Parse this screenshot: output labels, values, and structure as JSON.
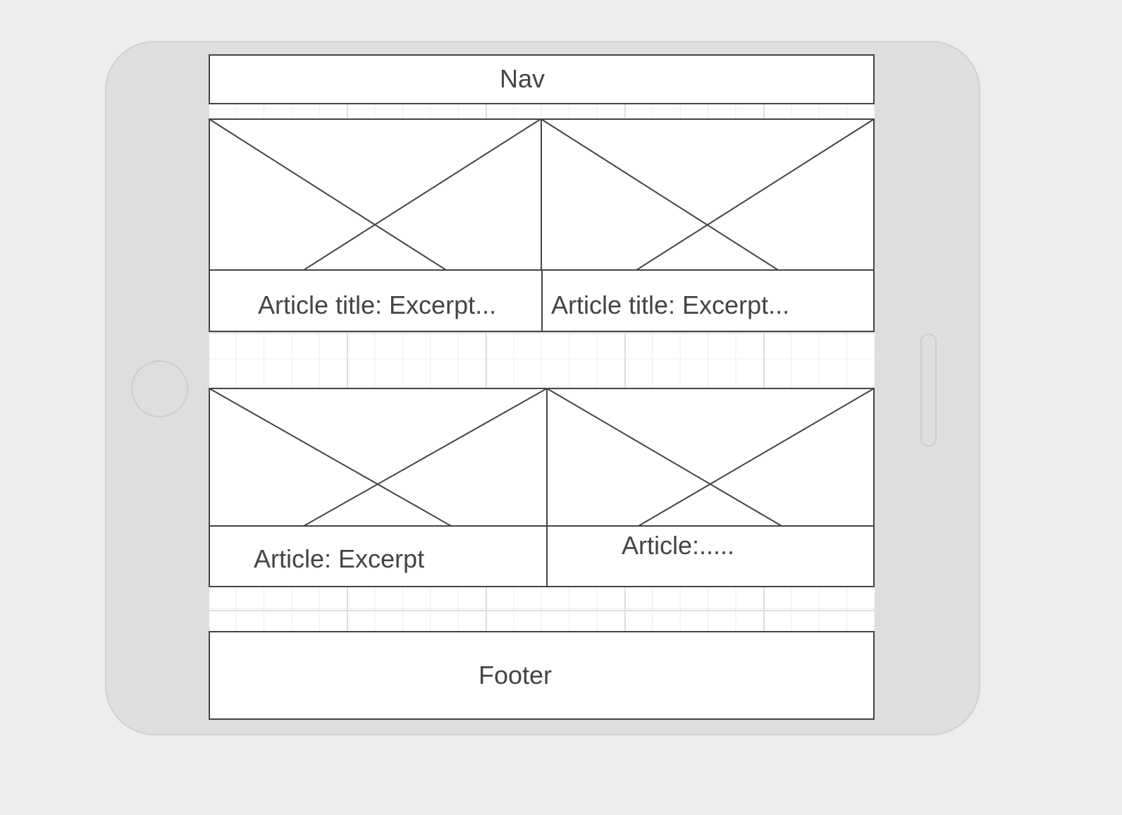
{
  "nav": {
    "label": "Nav"
  },
  "articles": [
    {
      "caption": "Article title: Excerpt..."
    },
    {
      "caption": "Article title: Excerpt..."
    },
    {
      "caption": "Article: Excerpt"
    },
    {
      "caption": "Article:....."
    }
  ],
  "footer": {
    "label": "Footer"
  },
  "colors": {
    "stroke": "#444444",
    "device": "#dedede",
    "background": "#ededed"
  },
  "icons": {
    "image_placeholder": "image-placeholder-icon"
  }
}
